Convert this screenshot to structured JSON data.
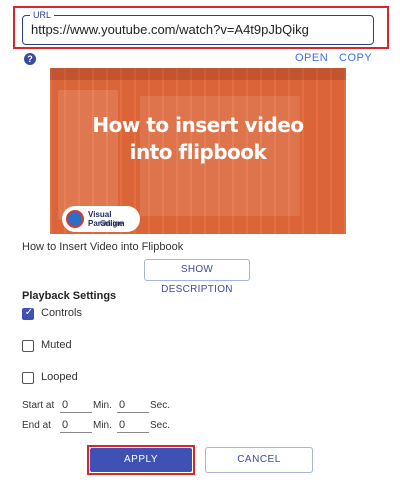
{
  "url_field": {
    "legend": "URL",
    "value": "https://www.youtube.com/watch?v=A4t9pJbQikg"
  },
  "help": {
    "icon": "help-icon",
    "glyph": "?"
  },
  "actions": {
    "open_label": "OPEN",
    "copy_label": "COPY"
  },
  "video": {
    "thumbnail_title_line1": "How to insert video",
    "thumbnail_title_line2": "into flipbook",
    "logo_line1": "Visual Paradigm",
    "logo_line2": "Online",
    "title": "How to Insert Video into Flipbook",
    "show_description_label": "SHOW DESCRIPTION"
  },
  "playback": {
    "section_title": "Playback Settings",
    "options": [
      {
        "label": "Controls",
        "checked": true
      },
      {
        "label": "Muted",
        "checked": false
      },
      {
        "label": "Looped",
        "checked": false
      }
    ],
    "start": {
      "label": "Start at",
      "min": "0",
      "min_label": "Min.",
      "sec": "0",
      "sec_label": "Sec."
    },
    "end": {
      "label": "End at",
      "min": "0",
      "min_label": "Min.",
      "sec": "0",
      "sec_label": "Sec."
    }
  },
  "buttons": {
    "apply_label": "APPLY",
    "cancel_label": "CANCEL"
  },
  "colors": {
    "accent": "#3f51b5",
    "highlight": "#d9262c",
    "thumbnail": "#e2683a",
    "link": "#3a6ee8"
  }
}
